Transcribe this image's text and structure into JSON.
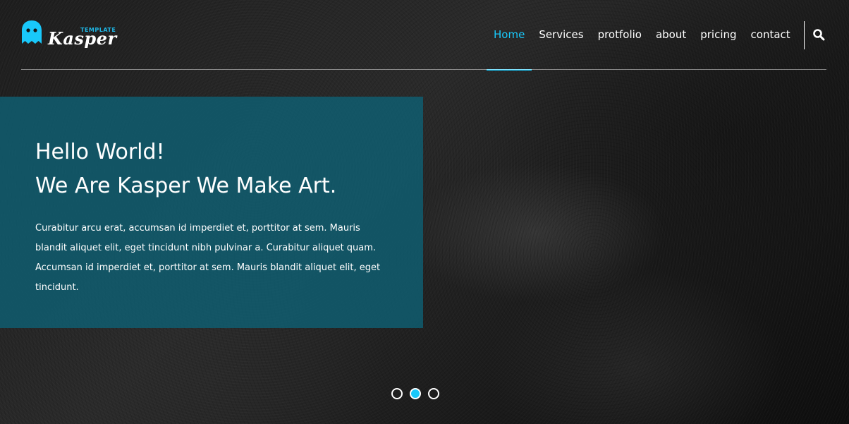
{
  "brand": {
    "tag": "TEMPLATE",
    "name": "Kasper",
    "icon": "ghost-icon",
    "accent_color": "#19c8fa"
  },
  "nav": {
    "items": [
      {
        "label": "Home",
        "active": true
      },
      {
        "label": "Services",
        "active": false
      },
      {
        "label": "protfolio",
        "active": false
      },
      {
        "label": "about",
        "active": false
      },
      {
        "label": "pricing",
        "active": false
      },
      {
        "label": "contact",
        "active": false
      }
    ],
    "search_icon": "search-icon"
  },
  "hero": {
    "title_line1": "Hello World!",
    "title_line2": "We Are Kasper We Make Art.",
    "paragraph": "Curabitur arcu erat, accumsan id imperdiet et, porttitor at sem. Mauris blandit aliquet elit, eget tincidunt nibh pulvinar a. Curabitur aliquet quam. Accumsan id imperdiet et, porttitor at sem. Mauris blandit aliquet elit, eget tincidunt.",
    "panel_color": "#0f5f73"
  },
  "slider": {
    "count": 3,
    "active_index": 1
  }
}
